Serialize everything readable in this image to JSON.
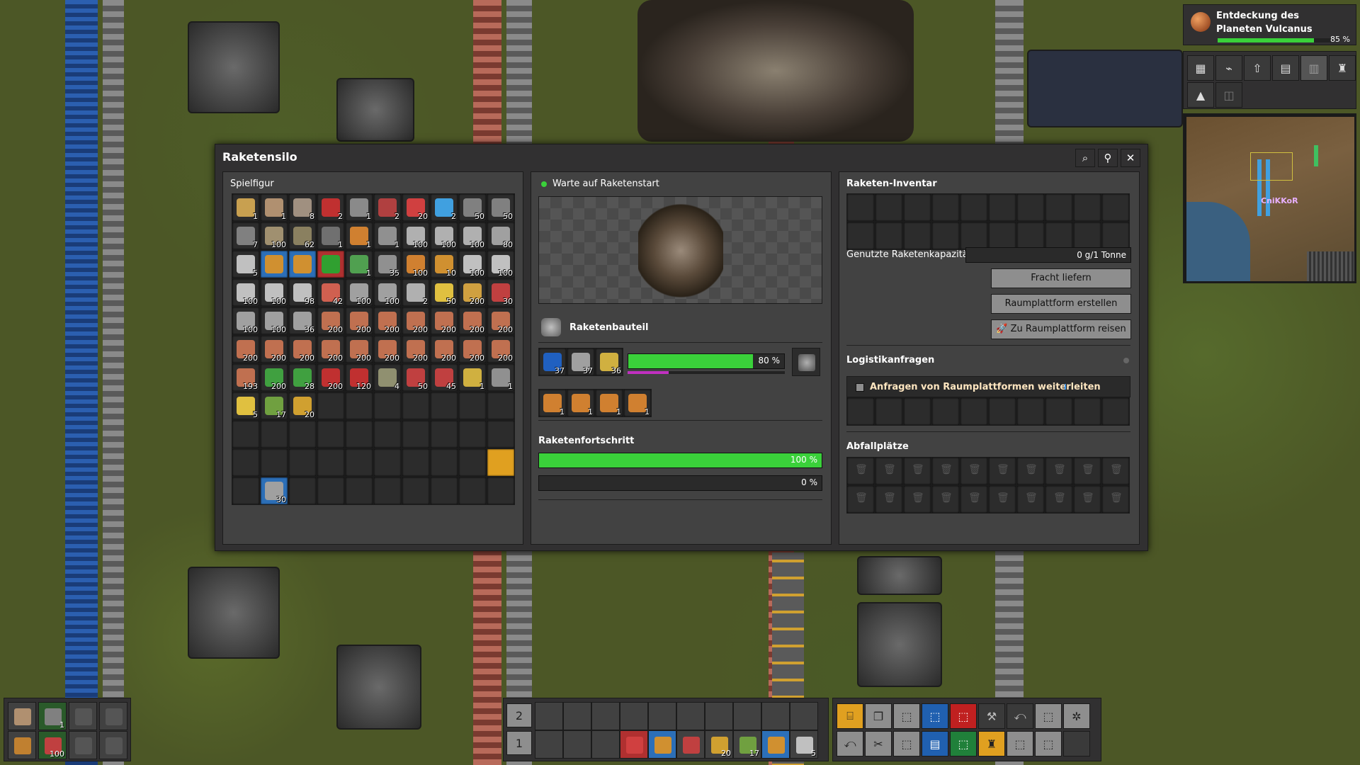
{
  "window": {
    "title": "Raketensilo",
    "search_icon": "search-icon",
    "network_icon": "network-icon",
    "close_icon": "close-icon"
  },
  "character": {
    "title": "Spielfigur",
    "slots": [
      {
        "c": "1",
        "col": "#c8a050"
      },
      {
        "c": "1",
        "col": "#b09070"
      },
      {
        "c": "8",
        "col": "#a09080"
      },
      {
        "c": "2",
        "col": "#c03030"
      },
      {
        "c": "1",
        "col": "#8a8a8a"
      },
      {
        "c": "2",
        "col": "#b04040"
      },
      {
        "c": "20",
        "col": "#d04040"
      },
      {
        "c": "2",
        "col": "#40a0e0"
      },
      {
        "c": "50",
        "col": "#808080"
      },
      {
        "c": "50",
        "col": "#808080"
      },
      {
        "c": "7",
        "col": "#808080"
      },
      {
        "c": "100",
        "col": "#a09070"
      },
      {
        "c": "62",
        "col": "#8a8060"
      },
      {
        "c": "1",
        "col": "#707070"
      },
      {
        "c": "1",
        "col": "#d08030"
      },
      {
        "c": "1",
        "col": "#909090"
      },
      {
        "c": "100",
        "col": "#b0b0b0"
      },
      {
        "c": "100",
        "col": "#b0b0b0"
      },
      {
        "c": "100",
        "col": "#b0b0b0"
      },
      {
        "c": "80",
        "col": "#a0a0a0"
      },
      {
        "c": "5",
        "col": "#c0c0c0"
      },
      {
        "c": "",
        "col": "#d09030",
        "bg": "blue"
      },
      {
        "c": "",
        "col": "#d09030",
        "bg": "blue"
      },
      {
        "c": "",
        "col": "#30a030",
        "bg": "red"
      },
      {
        "c": "1",
        "col": "#50a050"
      },
      {
        "c": "35",
        "col": "#909090"
      },
      {
        "c": "100",
        "col": "#d08030"
      },
      {
        "c": "10",
        "col": "#d09030"
      },
      {
        "c": "100",
        "col": "#c0c0c0"
      },
      {
        "c": "100",
        "col": "#c0c0c0"
      },
      {
        "c": "100",
        "col": "#c0c0c0"
      },
      {
        "c": "100",
        "col": "#c0c0c0"
      },
      {
        "c": "98",
        "col": "#c0c0c0"
      },
      {
        "c": "42",
        "col": "#d06050"
      },
      {
        "c": "100",
        "col": "#a0a0a0"
      },
      {
        "c": "100",
        "col": "#a0a0a0"
      },
      {
        "c": "2",
        "col": "#b0b0b0"
      },
      {
        "c": "50",
        "col": "#e0c040"
      },
      {
        "c": "200",
        "col": "#d0a040"
      },
      {
        "c": "30",
        "col": "#c04040"
      },
      {
        "c": "100",
        "col": "#a0a0a0"
      },
      {
        "c": "100",
        "col": "#a0a0a0"
      },
      {
        "c": "36",
        "col": "#a0a0a0"
      },
      {
        "c": "200",
        "col": "#c07050"
      },
      {
        "c": "200",
        "col": "#c07050"
      },
      {
        "c": "200",
        "col": "#c07050"
      },
      {
        "c": "200",
        "col": "#c07050"
      },
      {
        "c": "200",
        "col": "#c07050"
      },
      {
        "c": "200",
        "col": "#c07050"
      },
      {
        "c": "200",
        "col": "#c07050"
      },
      {
        "c": "200",
        "col": "#c07050"
      },
      {
        "c": "200",
        "col": "#c07050"
      },
      {
        "c": "200",
        "col": "#c07050"
      },
      {
        "c": "200",
        "col": "#c07050"
      },
      {
        "c": "200",
        "col": "#c07050"
      },
      {
        "c": "200",
        "col": "#c07050"
      },
      {
        "c": "200",
        "col": "#c07050"
      },
      {
        "c": "200",
        "col": "#c07050"
      },
      {
        "c": "200",
        "col": "#c07050"
      },
      {
        "c": "200",
        "col": "#c07050"
      },
      {
        "c": "193",
        "col": "#c07050"
      },
      {
        "c": "200",
        "col": "#40a040"
      },
      {
        "c": "28",
        "col": "#40a040"
      },
      {
        "c": "200",
        "col": "#c03030"
      },
      {
        "c": "120",
        "col": "#c03030"
      },
      {
        "c": "4",
        "col": "#909070"
      },
      {
        "c": "50",
        "col": "#c04040"
      },
      {
        "c": "45",
        "col": "#c04040"
      },
      {
        "c": "1",
        "col": "#d0b040"
      },
      {
        "c": "1",
        "col": "#909090"
      },
      {
        "c": "5",
        "col": "#e0c040"
      },
      {
        "c": "17",
        "col": "#70a040"
      },
      {
        "c": "20",
        "col": "#d0a030"
      },
      {
        "c": "",
        "col": ""
      },
      {
        "c": "",
        "col": ""
      },
      {
        "c": "",
        "col": ""
      },
      {
        "c": "",
        "col": ""
      },
      {
        "c": "",
        "col": ""
      },
      {
        "c": "",
        "col": ""
      },
      {
        "c": "",
        "col": ""
      },
      {
        "c": "",
        "col": ""
      },
      {
        "c": "",
        "col": ""
      },
      {
        "c": "",
        "col": ""
      },
      {
        "c": "",
        "col": ""
      },
      {
        "c": "",
        "col": ""
      },
      {
        "c": "",
        "col": ""
      },
      {
        "c": "",
        "col": ""
      },
      {
        "c": "",
        "col": ""
      },
      {
        "c": "",
        "col": ""
      },
      {
        "c": "",
        "col": ""
      },
      {
        "c": "",
        "col": ""
      },
      {
        "c": "",
        "col": ""
      },
      {
        "c": "",
        "col": ""
      },
      {
        "c": "",
        "col": ""
      },
      {
        "c": "",
        "col": ""
      },
      {
        "c": "",
        "col": ""
      },
      {
        "c": "",
        "col": ""
      },
      {
        "c": "",
        "col": ""
      },
      {
        "c": "",
        "col": ""
      },
      {
        "c": "",
        "col": "",
        "bg": "sel"
      },
      {
        "c": "",
        "col": ""
      },
      {
        "c": "30",
        "col": "#a0a0a0",
        "bg": "blue"
      },
      {
        "c": "",
        "col": ""
      },
      {
        "c": "",
        "col": ""
      },
      {
        "c": "",
        "col": ""
      },
      {
        "c": "",
        "col": ""
      },
      {
        "c": "",
        "col": ""
      },
      {
        "c": "",
        "col": ""
      },
      {
        "c": "",
        "col": ""
      },
      {
        "c": "",
        "col": ""
      }
    ]
  },
  "silo": {
    "status": "Warte auf Raketenstart",
    "part_label": "Raketenbauteil",
    "ingredients": [
      {
        "c": "37",
        "col": "#2060c0"
      },
      {
        "c": "37",
        "col": "#a0a0a0"
      },
      {
        "c": "36",
        "col": "#d0b040"
      }
    ],
    "crafting_percent": 80,
    "crafting_label": "80 %",
    "product_icon": "rocket-part-icon",
    "module_slots": [
      {
        "c": "1",
        "col": "#d08030"
      },
      {
        "c": "1",
        "col": "#d08030"
      },
      {
        "c": "1",
        "col": "#d08030"
      },
      {
        "c": "1",
        "col": "#d08030"
      }
    ],
    "progress_title": "Raketenfortschritt",
    "progress1_percent": 100,
    "progress1_label": "100 %",
    "progress2_percent": 0,
    "progress2_label": "0 %"
  },
  "rocket": {
    "title": "Raketen-Inventar",
    "capacity_label": "Genutzte Raketenkapazität",
    "capacity_value": "0 g/1 Tonne",
    "btn_deliver": "Fracht liefern",
    "btn_create": "Raumplattform erstellen",
    "btn_travel": "Zu Raumplattform reisen",
    "logistics_title": "Logistikanfragen",
    "forward_label": "Anfragen von Raumplattformen weiterleiten",
    "info": "i",
    "trash_title": "Abfallplätze"
  },
  "research": {
    "title": "Entdeckung des Planeten Vulcanus",
    "percent": 85,
    "label": "85 %"
  },
  "map": {
    "player_name": "CniKKoR"
  },
  "quickbar": {
    "row2": "2",
    "row1": "1",
    "slots": [
      {
        "c": "",
        "col": "#d04040",
        "bg": "red"
      },
      {
        "c": "",
        "col": "#d09030",
        "bg": "blue"
      },
      {
        "c": "",
        "col": "#c04040"
      },
      {
        "c": "20",
        "col": "#d0a030"
      },
      {
        "c": "17",
        "col": "#70a040"
      },
      {
        "c": "",
        "col": "#d09030",
        "bg": "blue"
      },
      {
        "c": "5",
        "col": "#c0c0c0"
      }
    ]
  },
  "left_hud": {
    "gun_count": "1",
    "ammo_count": "100"
  }
}
